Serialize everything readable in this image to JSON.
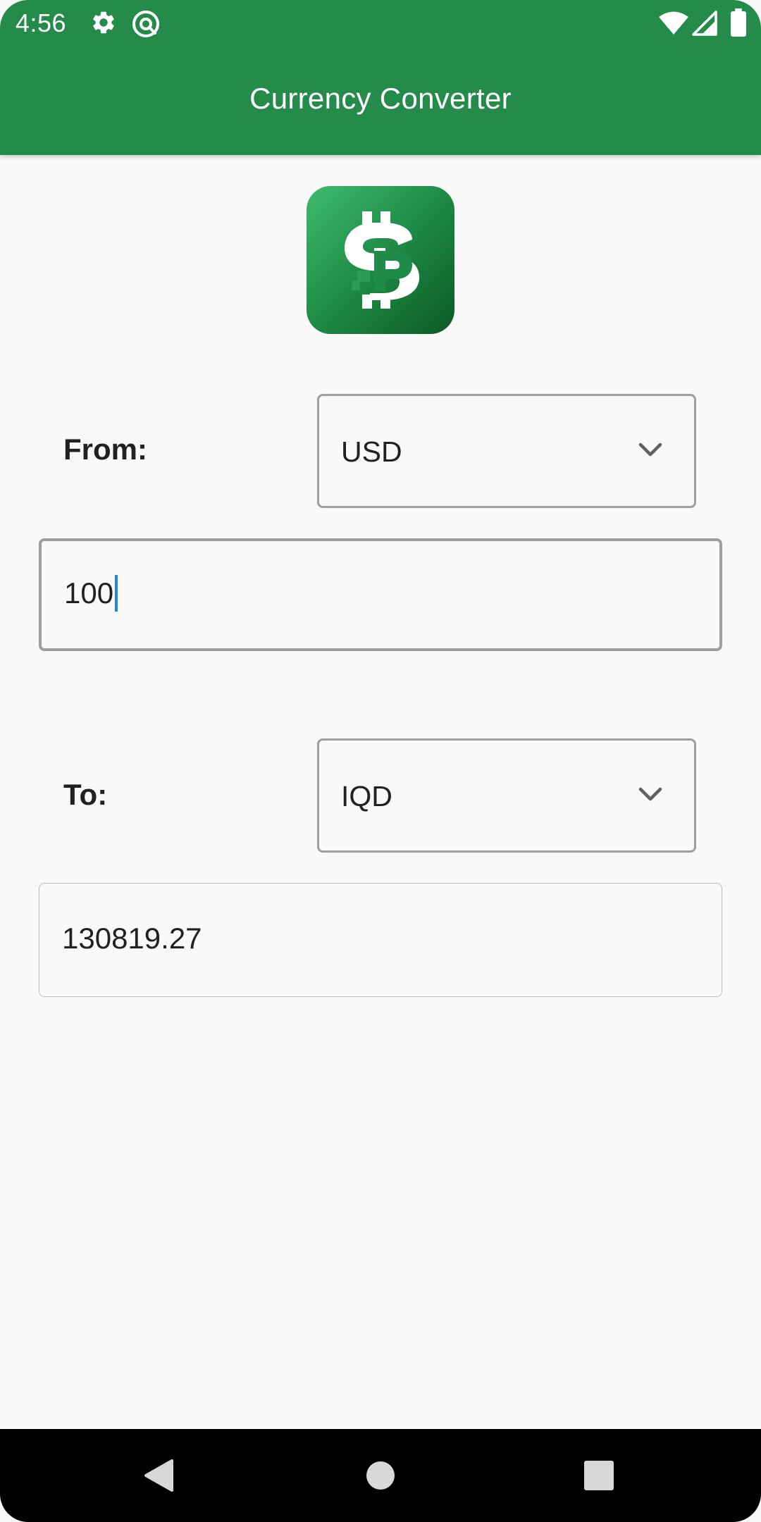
{
  "status_bar": {
    "time": "4:56",
    "left_icons": [
      "gear-icon",
      "at-sign-icon"
    ],
    "right_icons": [
      "wifi-icon",
      "signal-icon",
      "battery-icon"
    ]
  },
  "app_bar": {
    "title": "Currency Converter",
    "color": "#258B4A"
  },
  "logo": {
    "icon": "currency-symbol-icon"
  },
  "from": {
    "label": "From:",
    "currency": "USD",
    "amount": "100"
  },
  "to": {
    "label": "To:",
    "currency": "IQD",
    "amount": "130819.27"
  },
  "nav_bar": {
    "buttons": [
      "back-icon",
      "home-icon",
      "recents-icon"
    ]
  },
  "colors": {
    "primary": "#258B4A",
    "background": "#F9F9F9",
    "caret": "#1E88E5"
  }
}
